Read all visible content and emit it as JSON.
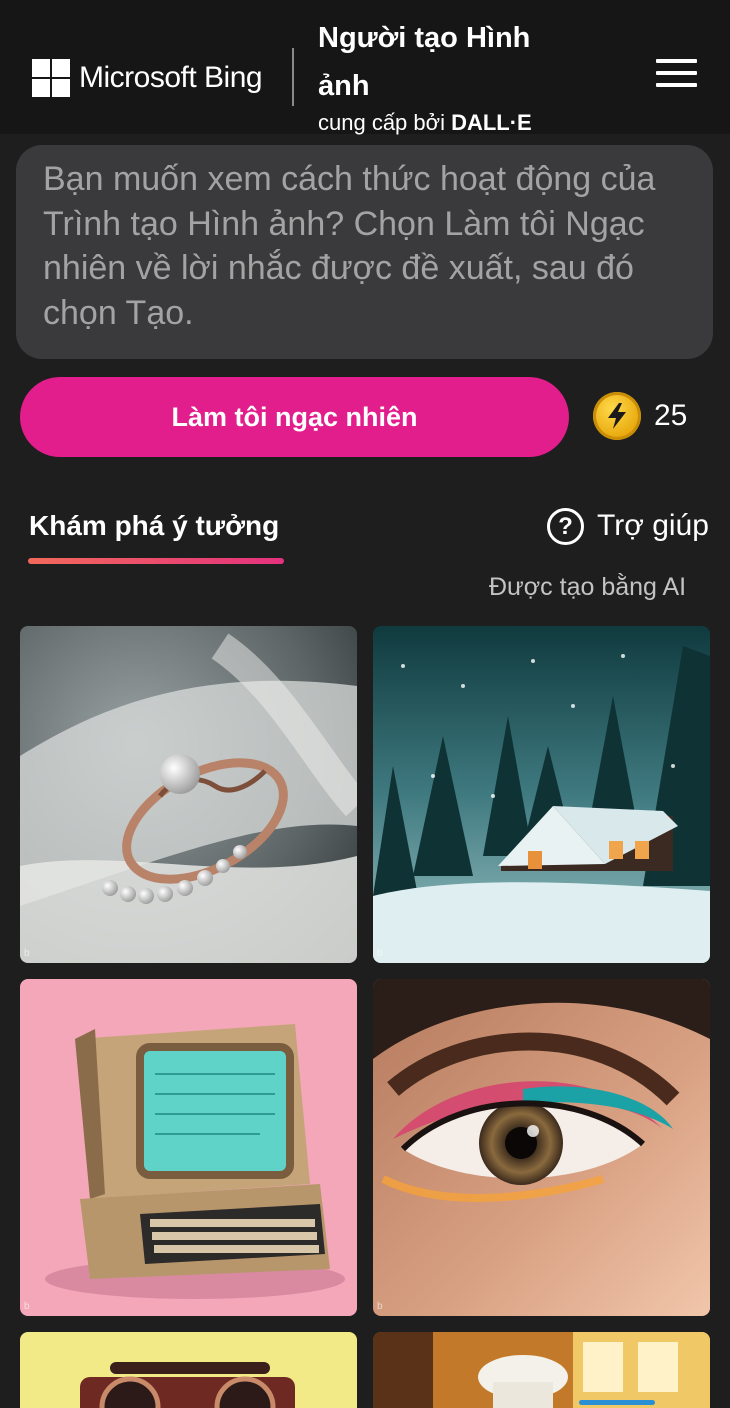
{
  "header": {
    "brand": "Microsoft Bing",
    "title": "Người tạo Hình ảnh",
    "subtitle_prefix": "cung cấp bởi",
    "subtitle_brand": "DALL·E",
    "menu_icon": "hamburger-menu-icon"
  },
  "prompt": {
    "placeholder": "Bạn muốn xem cách thức hoạt động của Trình tạo Hình ảnh? Chọn Làm tôi Ngạc nhiên về lời nhắc được đề xuất, sau đó chọn Tạo."
  },
  "actions": {
    "surprise_label": "Làm tôi ngạc nhiên",
    "boost_icon": "lightning-coin-icon",
    "boost_count": "25"
  },
  "tabs": {
    "explore_label": "Khám phá ý tưởng",
    "help_icon": "question-circle-icon",
    "help_label": "Trợ giúp",
    "ai_note": "Được tạo bằng AI"
  },
  "gallery": {
    "items": [
      {
        "subject": "pearl-ring"
      },
      {
        "subject": "snowy-cabin"
      },
      {
        "subject": "retro-computer"
      },
      {
        "subject": "eye-makeup"
      },
      {
        "subject": "boombox"
      },
      {
        "subject": "chef"
      }
    ]
  },
  "colors": {
    "background": "#1e1e1f",
    "header": "#161617",
    "accent": "#e21d8c",
    "prompt_box": "#3a3a3c",
    "coin": "#f2b81e"
  }
}
